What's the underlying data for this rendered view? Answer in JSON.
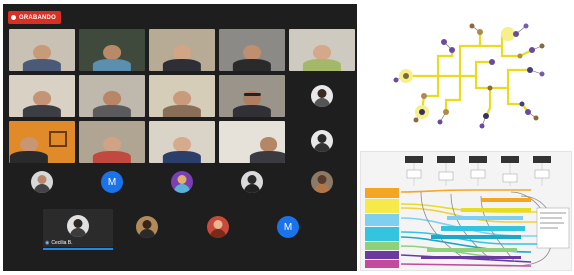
{
  "call": {
    "recording_label": "GRABANDO",
    "active_speaker_name": "Cecilia B.",
    "avatar_letter": "M",
    "colors": {
      "background": "#1e1e1e",
      "recording": "#d93025",
      "accent": "#1a73e8",
      "speaking_bar": "#1e88e5"
    }
  },
  "icons": {
    "recording": "record-dot-icon",
    "mic": "microphone-icon"
  }
}
